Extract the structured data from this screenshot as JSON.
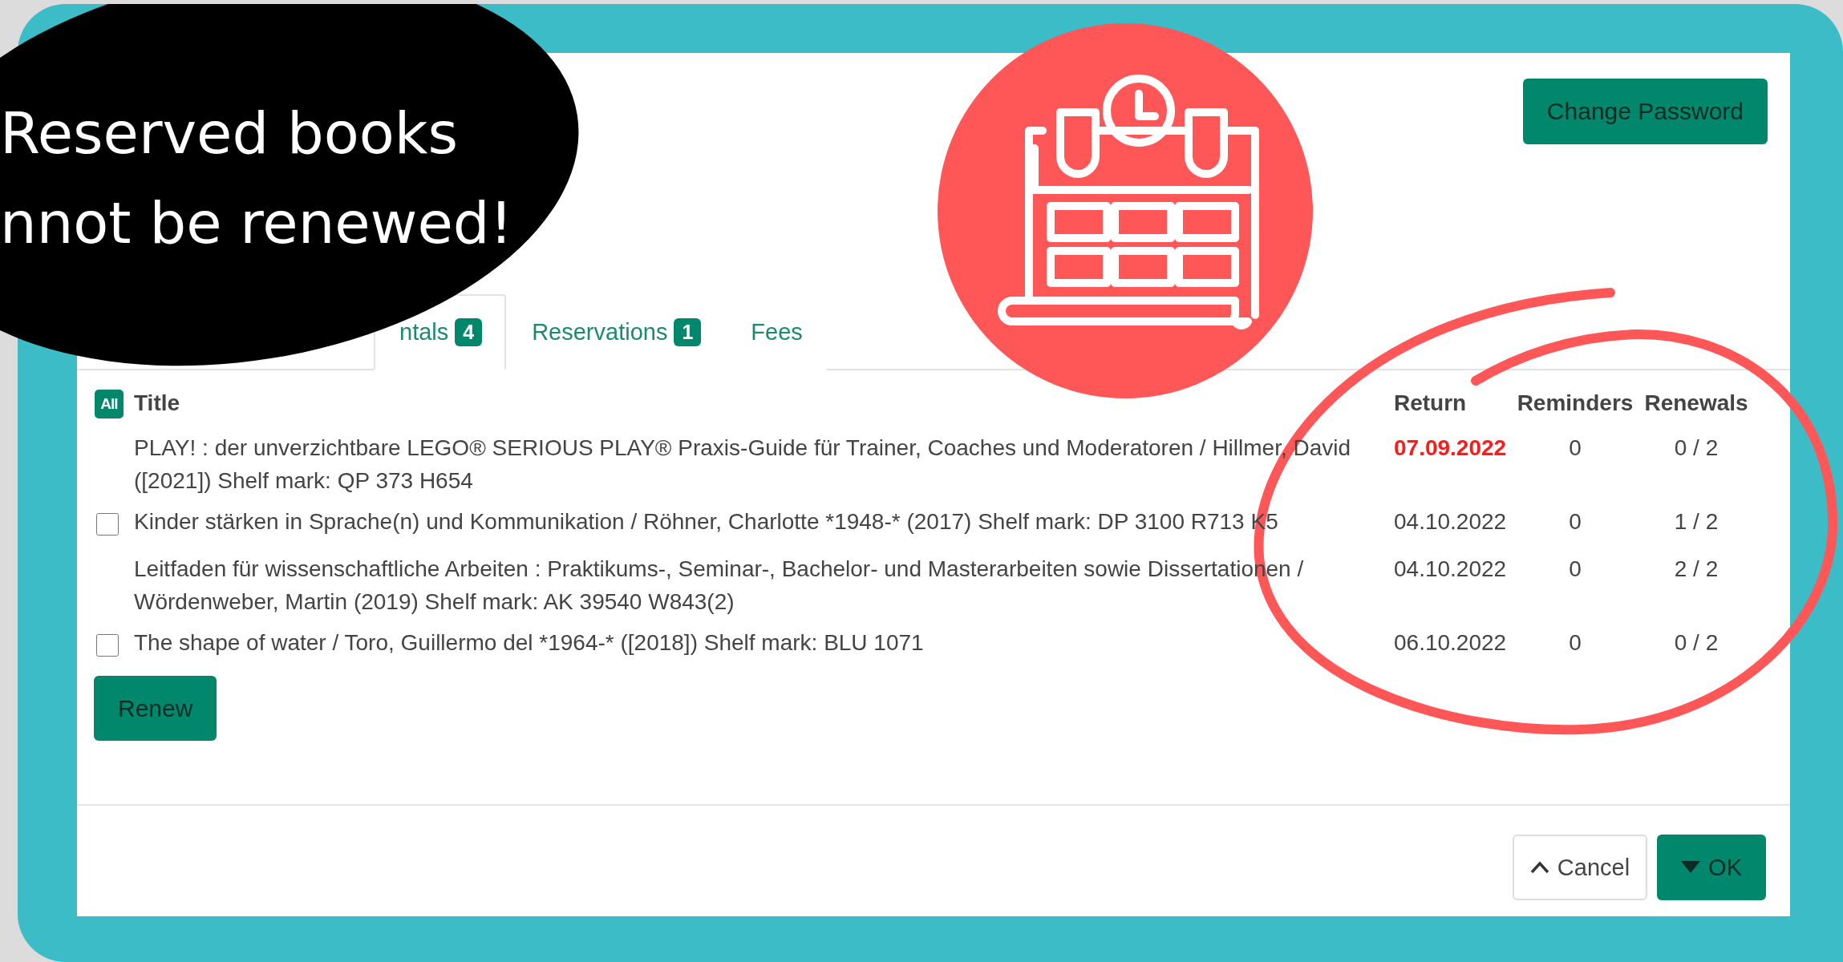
{
  "callout": {
    "lines": [
      "Reserved books",
      "nnot be renewed!"
    ]
  },
  "header": {
    "button": "Change Password"
  },
  "tabs": [
    {
      "label": "ntals",
      "badge": "4",
      "selected": true
    },
    {
      "label": "Reservations",
      "badge": "1",
      "selected": false
    },
    {
      "label": "Fees",
      "selected": false
    }
  ],
  "table": {
    "select_all": "All",
    "columns": [
      "Title",
      "Return",
      "Reminders",
      "Renewals"
    ],
    "rows": [
      {
        "title": "PLAY! : der unverzichtbare LEGO® SERIOUS PLAY® Praxis-Guide für Trainer, Coaches und Moderatoren / Hillmer, David ([2021]) Shelf mark: QP 373 H654",
        "return": "07.09.2022",
        "overdue": true,
        "reminders": "0",
        "renewals": "0 / 2",
        "selectable": false
      },
      {
        "title": "Kinder stärken in Sprache(n) und Kommunikation / Röhner, Charlotte *1948-* (2017) Shelf mark: DP 3100 R713 K5",
        "return": "04.10.2022",
        "overdue": false,
        "reminders": "0",
        "renewals": "1 / 2",
        "selectable": true,
        "checked": false
      },
      {
        "title": "Leitfaden für wissenschaftliche Arbeiten : Praktikums-, Seminar-, Bachelor- und Masterarbeiten sowie Dissertationen / Wördenweber, Martin (2019) Shelf mark: AK 39540 W843(2)",
        "return": "04.10.2022",
        "overdue": false,
        "reminders": "0",
        "renewals": "2 / 2",
        "selectable": false
      },
      {
        "title": "The shape of water / Toro, Guillermo del *1964-* ([2018]) Shelf mark: BLU 1071",
        "return": "06.10.2022",
        "overdue": false,
        "reminders": "0",
        "renewals": "0 / 2",
        "selectable": true,
        "checked": false
      }
    ]
  },
  "renew_button": "Renew",
  "footer": {
    "buttons": [
      {
        "label": "Cancel",
        "kind": "cancel"
      },
      {
        "label": "OK",
        "kind": "ok"
      }
    ]
  }
}
